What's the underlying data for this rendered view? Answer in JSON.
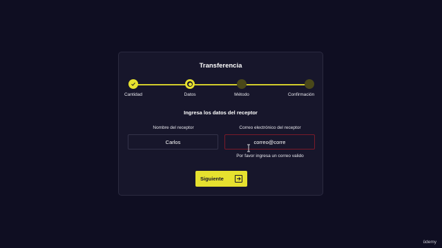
{
  "card": {
    "title": "Transferencia",
    "steps": [
      {
        "label": "Cantidad",
        "state": "done"
      },
      {
        "label": "Datos",
        "state": "current"
      },
      {
        "label": "Método",
        "state": "pending"
      },
      {
        "label": "Confirmación",
        "state": "pending"
      }
    ],
    "subtitle": "Ingresa los datos del receptor",
    "name_field": {
      "label": "Nombre del receptor",
      "value": "Carlos"
    },
    "email_field": {
      "label": "Correo electrónico del receptor",
      "value": "correo@corre",
      "error": "Por favor ingresa un correo valido"
    },
    "next_button": {
      "label": "Siguiente"
    }
  },
  "watermark": "ûdemy",
  "colors": {
    "background": "#0f0e22",
    "card": "#17162b",
    "accent": "#e6e12f",
    "pending": "#4a4819",
    "error_border": "#7a1a2a"
  }
}
